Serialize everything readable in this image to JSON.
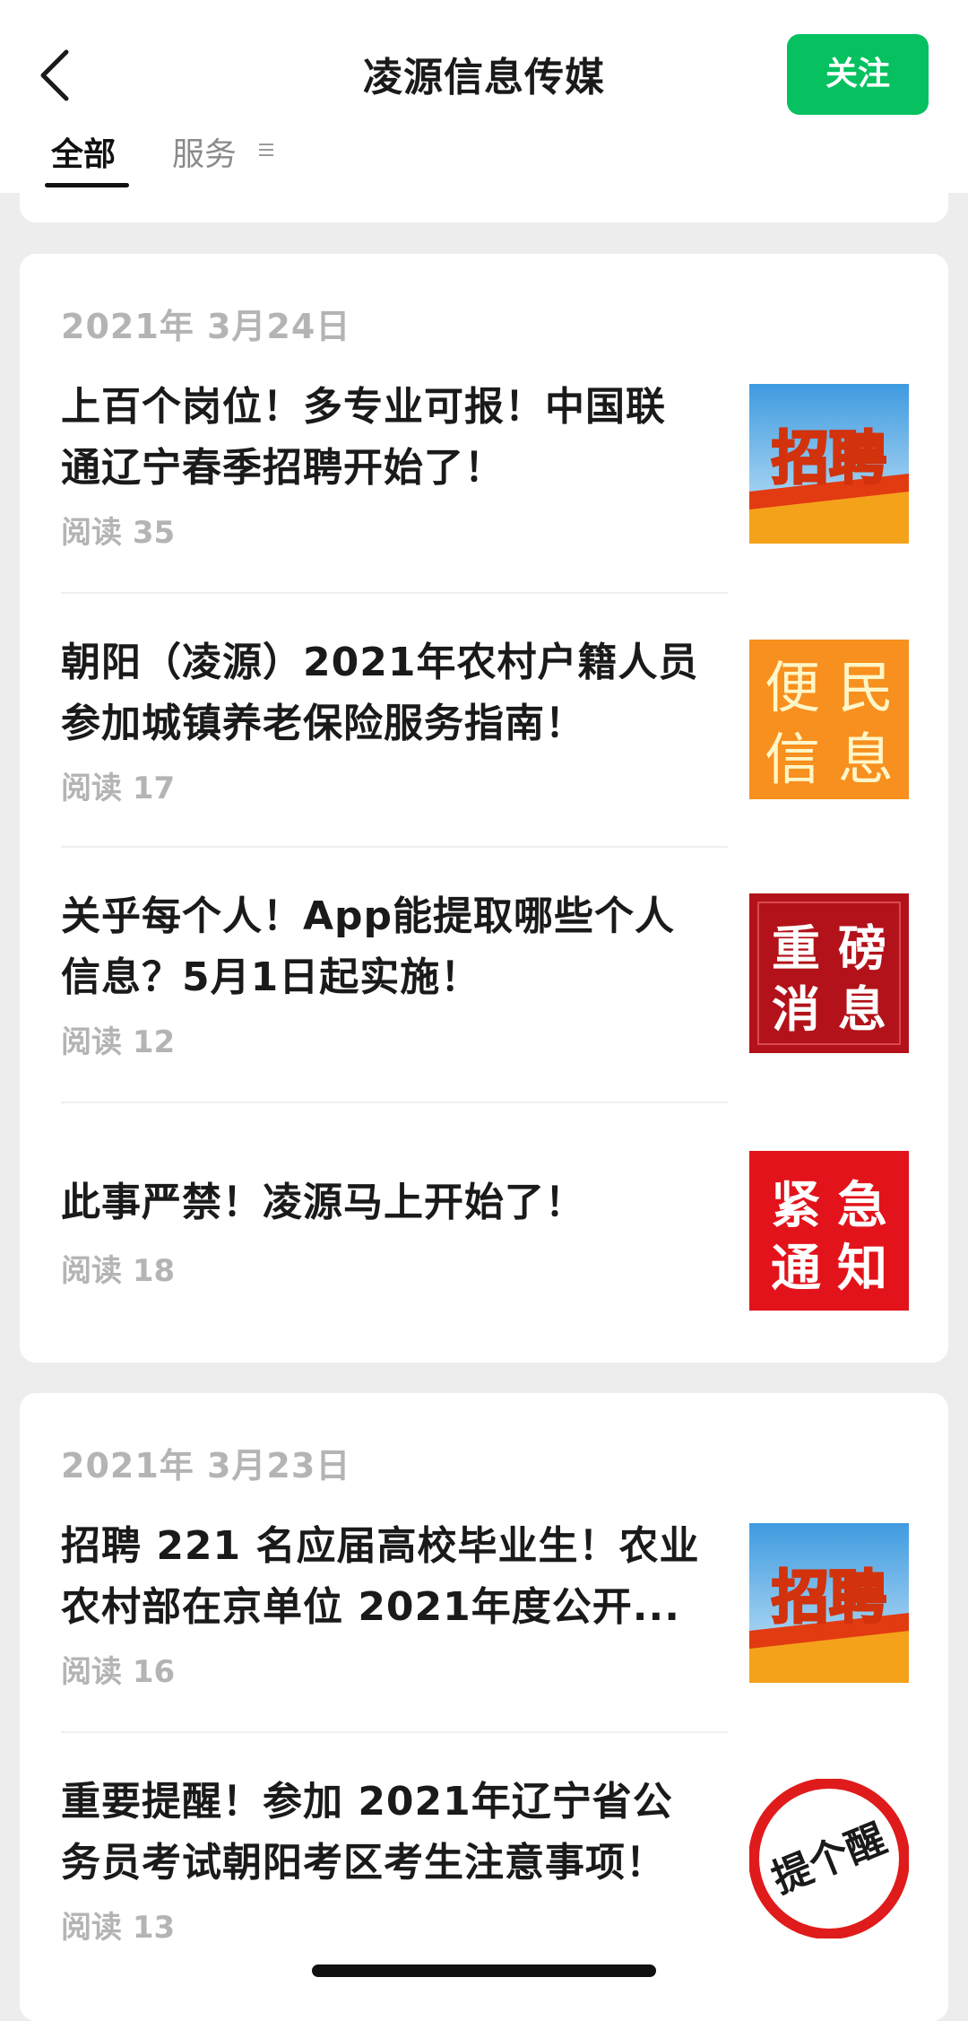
{
  "header": {
    "title": "凌源信息传媒",
    "follow_label": "关注",
    "tabs": [
      {
        "label": "全部",
        "active": true
      },
      {
        "label": "服务",
        "active": false
      }
    ]
  },
  "groups": [
    {
      "date": "2021年 3月24日",
      "articles": [
        {
          "title_lines": [
            "上百个岗位！多专业可报！中国联",
            "通辽宁春季招聘开始了！"
          ],
          "reads": "阅读 35",
          "thumb": {
            "type": "banner",
            "text": "招聘"
          }
        },
        {
          "title_lines": [
            "朝阳（凌源）2021年农村户籍人员",
            "参加城镇养老保险服务指南！"
          ],
          "reads": "阅读 17",
          "thumb": {
            "type": "grid",
            "chars": [
              "便",
              "民",
              "信",
              "息"
            ],
            "bg": "#f7901e"
          }
        },
        {
          "title_lines": [
            "关乎每个人！App能提取哪些个人",
            "信息？5月1日起实施！"
          ],
          "reads": "阅读 12",
          "thumb": {
            "type": "grid",
            "chars": [
              "重",
              "磅",
              "消",
              "息"
            ],
            "bg": "#b3121a"
          }
        },
        {
          "title_lines": [
            "此事严禁！凌源马上开始了！"
          ],
          "reads": "阅读 18",
          "thumb": {
            "type": "grid",
            "chars": [
              "紧",
              "急",
              "通",
              "知"
            ],
            "bg": "#e3131b"
          }
        }
      ]
    },
    {
      "date": "2021年 3月23日",
      "articles": [
        {
          "title_lines": [
            "招聘 221 名应届高校毕业生！农业",
            "农村部在京单位 2021年度公开..."
          ],
          "reads": "阅读 16",
          "thumb": {
            "type": "banner",
            "text": "招聘"
          }
        },
        {
          "title_lines": [
            "重要提醒！参加 2021年辽宁省公",
            "务员考试朝阳考区考生注意事项！"
          ],
          "reads": "阅读 13",
          "thumb": {
            "type": "sign",
            "text": "提个醒"
          }
        }
      ]
    }
  ],
  "colors": {
    "accent": "#07c160",
    "background": "#ededed",
    "muted_text": "#b4b4b4"
  },
  "icons": {
    "back": "chevron-left-icon",
    "tab_menu": "menu-lines-icon"
  }
}
